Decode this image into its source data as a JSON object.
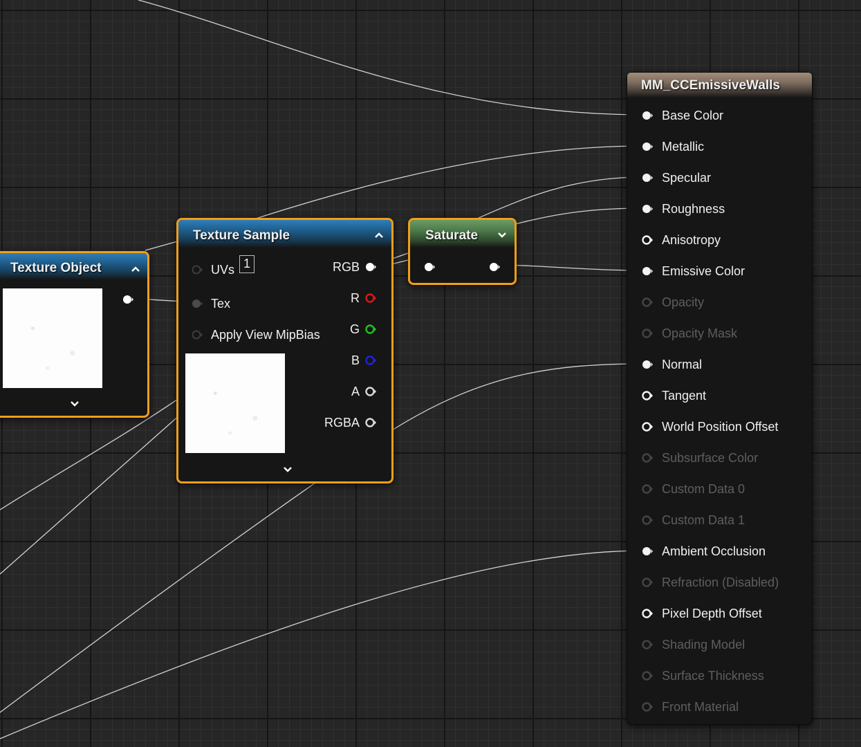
{
  "colors": {
    "selection_outline": "#f29e1a",
    "texture_header": "#1f5f8f",
    "saturate_header": "#4f7e4d",
    "result_header": "#7e6d5e",
    "pin_r": "#e01515",
    "pin_g": "#1fc21f",
    "pin_b": "#1c24e0"
  },
  "texture_object": {
    "title": "Texture Object",
    "collapse_icon": "chevron-up-icon",
    "expand_icon": "chevron-down-icon"
  },
  "texture_sample": {
    "title": "Texture Sample",
    "inputs": [
      {
        "label": "UVs",
        "value": "1"
      },
      {
        "label": "Tex"
      },
      {
        "label": "Apply View MipBias"
      }
    ],
    "outputs": [
      "RGB",
      "R",
      "G",
      "B",
      "A",
      "RGBA"
    ]
  },
  "saturate": {
    "title": "Saturate"
  },
  "material": {
    "title": "MM_CCEmissiveWalls",
    "pins": [
      {
        "label": "Base Color",
        "connected": true,
        "enabled": true
      },
      {
        "label": "Metallic",
        "connected": true,
        "enabled": true
      },
      {
        "label": "Specular",
        "connected": true,
        "enabled": true
      },
      {
        "label": "Roughness",
        "connected": true,
        "enabled": true
      },
      {
        "label": "Anisotropy",
        "connected": false,
        "enabled": true
      },
      {
        "label": "Emissive Color",
        "connected": true,
        "enabled": true
      },
      {
        "label": "Opacity",
        "connected": false,
        "enabled": false
      },
      {
        "label": "Opacity Mask",
        "connected": false,
        "enabled": false
      },
      {
        "label": "Normal",
        "connected": true,
        "enabled": true
      },
      {
        "label": "Tangent",
        "connected": false,
        "enabled": true
      },
      {
        "label": "World Position Offset",
        "connected": false,
        "enabled": true
      },
      {
        "label": "Subsurface Color",
        "connected": false,
        "enabled": false
      },
      {
        "label": "Custom Data 0",
        "connected": false,
        "enabled": false
      },
      {
        "label": "Custom Data 1",
        "connected": false,
        "enabled": false
      },
      {
        "label": "Ambient Occlusion",
        "connected": true,
        "enabled": true
      },
      {
        "label": "Refraction (Disabled)",
        "connected": false,
        "enabled": false
      },
      {
        "label": "Pixel Depth Offset",
        "connected": false,
        "enabled": true
      },
      {
        "label": "Shading Model",
        "connected": false,
        "enabled": false
      },
      {
        "label": "Surface Thickness",
        "connected": false,
        "enabled": false
      },
      {
        "label": "Front Material",
        "connected": false,
        "enabled": false
      }
    ]
  }
}
